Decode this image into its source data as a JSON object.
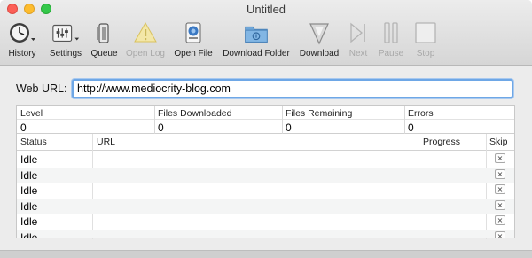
{
  "window": {
    "title": "Untitled"
  },
  "toolbar": {
    "history": "History",
    "settings": "Settings",
    "queue": "Queue",
    "open_log": "Open Log",
    "open_file": "Open File",
    "download_folder": "Download Folder",
    "download": "Download",
    "next": "Next",
    "pause": "Pause",
    "stop": "Stop"
  },
  "url": {
    "label": "Web URL:",
    "value": "http://www.mediocrity-blog.com"
  },
  "stats": {
    "level": {
      "label": "Level",
      "value": "0"
    },
    "files_downloaded": {
      "label": "Files Downloaded",
      "value": "0"
    },
    "files_remaining": {
      "label": "Files Remaining",
      "value": "0"
    },
    "errors": {
      "label": "Errors",
      "value": "0"
    }
  },
  "table": {
    "columns": {
      "status": "Status",
      "url": "URL",
      "progress": "Progress",
      "skip": "Skip"
    },
    "rows": [
      {
        "status": "Idle",
        "skip": "×"
      },
      {
        "status": "Idle",
        "skip": "×"
      },
      {
        "status": "Idle",
        "skip": "×"
      },
      {
        "status": "Idle",
        "skip": "×"
      },
      {
        "status": "Idle",
        "skip": "×"
      },
      {
        "status": "Idle",
        "skip": "×"
      }
    ]
  },
  "icons": {
    "history": "clock-icon",
    "settings": "gear-icon",
    "queue": "queue-icon",
    "open_log": "warning-icon",
    "open_file": "file-icon",
    "download_folder": "folder-icon",
    "download": "download-arrow-icon",
    "next": "next-icon",
    "pause": "pause-icon",
    "stop": "stop-icon"
  }
}
